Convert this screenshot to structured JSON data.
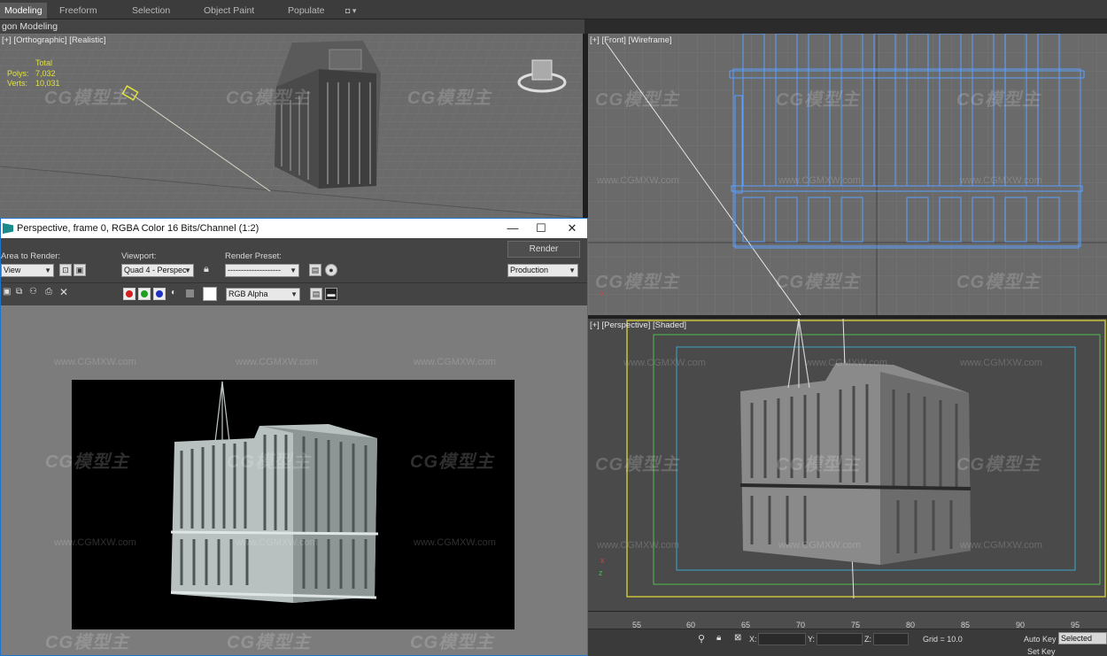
{
  "ribbon": {
    "tabs": [
      "Modeling",
      "Freeform",
      "Selection",
      "Object Paint",
      "Populate"
    ],
    "active_tab": "Modeling",
    "subtitle": "gon Modeling"
  },
  "viewports": {
    "top": {
      "label": "[+] [Orthographic] [Realistic]",
      "stats": {
        "title": "Total",
        "polys_label": "Polys:",
        "polys_value": "7,032",
        "verts_label": "Verts:",
        "verts_value": "10,031"
      }
    },
    "front": {
      "label": "[+] [Front] [Wireframe]"
    },
    "perspective": {
      "label": "[+] [Perspective] [Shaded]"
    }
  },
  "render_window": {
    "title": "Perspective, frame 0, RGBA Color 16 Bits/Channel (1:2)",
    "minimize_glyph": "—",
    "maximize_glyph": "☐",
    "close_glyph": "✕",
    "area_to_render": {
      "label": "Area to Render:",
      "value": "View"
    },
    "viewport": {
      "label": "Viewport:",
      "value": "Quad 4 - Perspec"
    },
    "render_preset": {
      "label": "Render Preset:",
      "value": "--------------------"
    },
    "render_button": "Render",
    "production": {
      "value": "Production"
    },
    "channel": {
      "value": "RGB Alpha"
    }
  },
  "timeline": {
    "ticks": [
      "55",
      "60",
      "65",
      "70",
      "75",
      "80",
      "85",
      "90",
      "95"
    ]
  },
  "status": {
    "x_label": "X:",
    "y_label": "Y:",
    "z_label": "Z:",
    "grid": "Grid = 10.0",
    "auto_key": "Auto Key",
    "auto_key_value": "Selected",
    "set_key": "Set Key"
  },
  "watermarks": {
    "logo": "CG模型主",
    "url": "www.CGMXW.com"
  },
  "colors": {
    "accent_blue": "#1e74c7",
    "wire_blue": "#5aa0ff",
    "safe_yellow": "#c9c23a",
    "safe_green": "#4fbf4f",
    "safe_cyan": "#3aa6c9"
  }
}
